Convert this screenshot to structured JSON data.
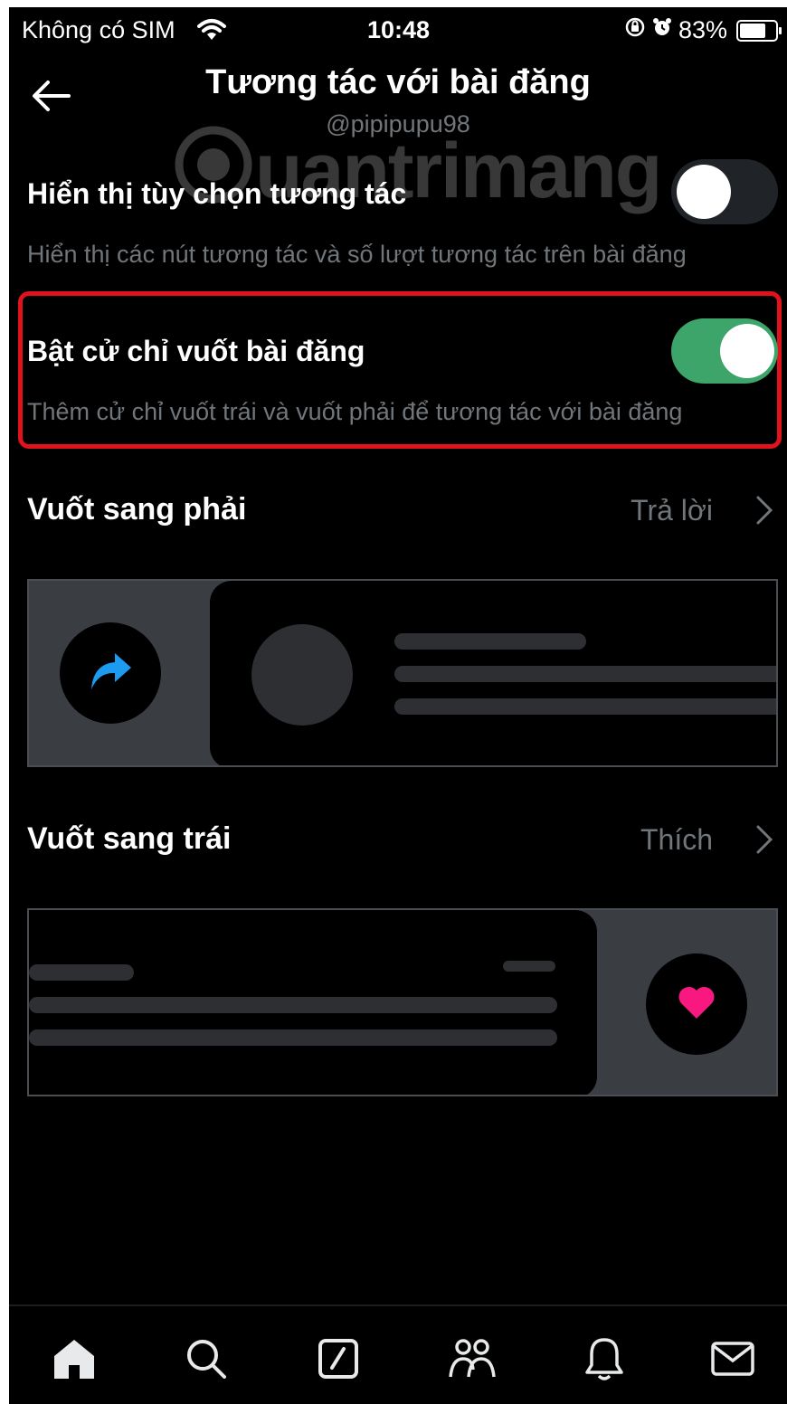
{
  "status_bar": {
    "carrier": "Không có SIM",
    "time": "10:48",
    "battery": "83%",
    "battery_level": 0.83,
    "icons": [
      "wifi-icon",
      "orientation-lock-icon",
      "alarm-icon",
      "battery-icon"
    ]
  },
  "header": {
    "title": "Tương tác với bài đăng",
    "handle": "@pipipupu98",
    "back_icon": "arrow-left-icon"
  },
  "watermark": "uantrimang",
  "settings": [
    {
      "label": "Hiển thị tùy chọn tương tác",
      "description": "Hiển thị các nút tương tác và số lượt tương tác trên bài đăng",
      "enabled": false
    },
    {
      "label": "Bật cử chỉ vuốt bài đăng",
      "description": "Thêm cử chỉ vuốt trái và vuốt phải để tương tác với bài đăng",
      "enabled": true
    }
  ],
  "swipe_right": {
    "label": "Vuốt sang phải",
    "value": "Trả lời",
    "action_icon": "reply-arrow-icon"
  },
  "swipe_left": {
    "label": "Vuốt sang trái",
    "value": "Thích",
    "action_icon": "heart-icon"
  },
  "tabbar": [
    "home-icon",
    "search-icon",
    "compose-icon",
    "communities-icon",
    "notifications-icon",
    "messages-icon"
  ],
  "colors": {
    "background": "#000000",
    "toggle_on": "#3da46a",
    "highlight": "#e0121c",
    "reply_icon": "#1d9bf0",
    "heart_icon": "#f91880",
    "secondary_text": "#71767b"
  }
}
